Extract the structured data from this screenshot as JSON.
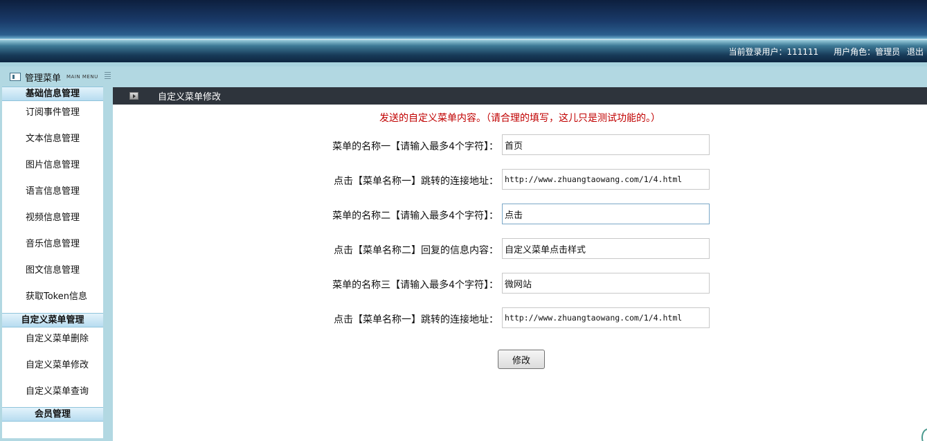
{
  "header": {
    "login_user_label": "当前登录用户：111111",
    "role_label": "用户角色：管理员",
    "logout": "退出"
  },
  "sidebar": {
    "title": "管理菜单",
    "subtitle": "MAIN MENU",
    "groups": [
      {
        "title": "基础信息管理",
        "items": [
          "订阅事件管理",
          "文本信息管理",
          "图片信息管理",
          "语言信息管理",
          "视频信息管理",
          "音乐信息管理",
          "图文信息管理",
          "获取Token信息"
        ]
      },
      {
        "title": "自定义菜单管理",
        "items": [
          "自定义菜单删除",
          "自定义菜单修改",
          "自定义菜单查询"
        ]
      },
      {
        "title": "会员管理",
        "items": []
      }
    ]
  },
  "main": {
    "page_title": "自定义菜单修改",
    "notice": "发送的自定义菜单内容。（请合理的填写，这儿只是测试功能的。）",
    "fields": [
      {
        "label": "菜单的名称一【请输入最多4个字符】：",
        "value": "首页"
      },
      {
        "label": "点击【菜单名称一】跳转的连接地址：",
        "value": "http://www.zhuangtaowang.com/1/4.html"
      },
      {
        "label": "菜单的名称二【请输入最多4个字符】：",
        "value": "点击"
      },
      {
        "label": "点击【菜单名称二】回复的信息内容：",
        "value": "自定义菜单点击样式"
      },
      {
        "label": "菜单的名称三【请输入最多4个字符】：",
        "value": "微网站"
      },
      {
        "label": "点击【菜单名称一】跳转的连接地址：",
        "value": "http://www.zhuangtaowang.com/1/4.html"
      }
    ],
    "submit_label": "修改"
  }
}
